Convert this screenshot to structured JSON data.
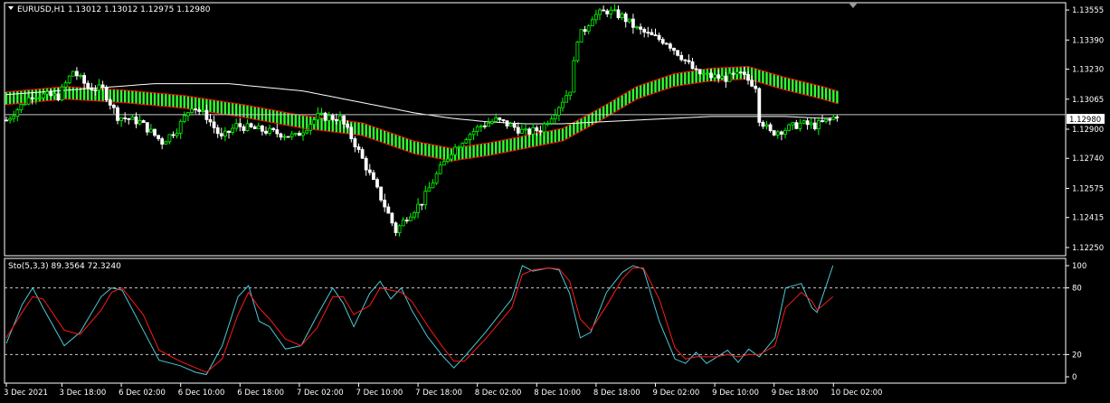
{
  "window": {
    "symbol_line": "EURUSD,H1  1.13012 1.13012 1.12975 1.12980",
    "sto_line": "Sto(5,3,3) 89.3564 72.3240",
    "current_price_label": "1.12980"
  },
  "colors": {
    "background": "#000000",
    "frame": "#ffffff",
    "bull_candle": "#00ff00",
    "bear_candle": "#ffffff",
    "ribbon_fill": "#32ff32",
    "ribbon_edge": "#ff0000",
    "slow_ma": "#ffffff",
    "sto_main": "#4dc8d6",
    "sto_signal": "#ff1a1a",
    "level_lines": "#c8c8c8"
  },
  "chart_data": [
    {
      "type": "candlestick",
      "title": "EURUSD,H1",
      "ohlc_header": {
        "open": 1.13012,
        "high": 1.13012,
        "low": 1.12975,
        "close": 1.1298
      },
      "y_ticks": [
        "1.13555",
        "1.13390",
        "1.13230",
        "1.13065",
        "1.12900",
        "1.12740",
        "1.12575",
        "1.12415",
        "1.12250"
      ],
      "ylim": [
        1.1221,
        1.1359
      ],
      "current_price": 1.1298,
      "x_ticks": [
        "3 Dec 2021",
        "3 Dec 18:00",
        "6 Dec 02:00",
        "6 Dec 10:00",
        "6 Dec 18:00",
        "7 Dec 02:00",
        "7 Dec 10:00",
        "7 Dec 18:00",
        "8 Dec 02:00",
        "8 Dec 10:00",
        "8 Dec 18:00",
        "9 Dec 02:00",
        "9 Dec 10:00",
        "9 Dec 18:00",
        "10 Dec 02:00"
      ],
      "x_tick_index": [
        0,
        15,
        31,
        47,
        63,
        79,
        95,
        111,
        127,
        143,
        159,
        175,
        191,
        207,
        223
      ],
      "close_path": [
        [
          0,
          1.1295
        ],
        [
          7,
          1.1309
        ],
        [
          14,
          1.1308
        ],
        [
          18,
          1.1322
        ],
        [
          22,
          1.1313
        ],
        [
          26,
          1.1312
        ],
        [
          30,
          1.1297
        ],
        [
          36,
          1.1294
        ],
        [
          42,
          1.1283
        ],
        [
          46,
          1.129
        ],
        [
          50,
          1.1303
        ],
        [
          54,
          1.1297
        ],
        [
          58,
          1.1285
        ],
        [
          62,
          1.1292
        ],
        [
          70,
          1.1289
        ],
        [
          78,
          1.1286
        ],
        [
          84,
          1.1297
        ],
        [
          90,
          1.1296
        ],
        [
          94,
          1.1282
        ],
        [
          98,
          1.1265
        ],
        [
          102,
          1.1248
        ],
        [
          105,
          1.1234
        ],
        [
          108,
          1.1242
        ],
        [
          112,
          1.125
        ],
        [
          116,
          1.1265
        ],
        [
          120,
          1.1278
        ],
        [
          124,
          1.1286
        ],
        [
          128,
          1.1292
        ],
        [
          132,
          1.1295
        ],
        [
          136,
          1.1292
        ],
        [
          140,
          1.1288
        ],
        [
          144,
          1.129
        ],
        [
          148,
          1.13
        ],
        [
          152,
          1.1312
        ],
        [
          154,
          1.134
        ],
        [
          156,
          1.1345
        ],
        [
          158,
          1.1352
        ],
        [
          162,
          1.1355
        ],
        [
          166,
          1.1352
        ],
        [
          170,
          1.1345
        ],
        [
          174,
          1.1341
        ],
        [
          178,
          1.1338
        ],
        [
          182,
          1.133
        ],
        [
          186,
          1.1321
        ],
        [
          190,
          1.1319
        ],
        [
          194,
          1.1318
        ],
        [
          198,
          1.132
        ],
        [
          202,
          1.1314
        ],
        [
          203,
          1.1296
        ],
        [
          206,
          1.1288
        ],
        [
          210,
          1.129
        ],
        [
          214,
          1.1293
        ],
        [
          218,
          1.1292
        ],
        [
          222,
          1.1295
        ],
        [
          224,
          1.1298
        ]
      ],
      "ribbon_path": [
        [
          0,
          1.1307
        ],
        [
          16,
          1.131
        ],
        [
          32,
          1.1308
        ],
        [
          48,
          1.1305
        ],
        [
          64,
          1.13
        ],
        [
          80,
          1.1294
        ],
        [
          96,
          1.129
        ],
        [
          110,
          1.128
        ],
        [
          120,
          1.1276
        ],
        [
          130,
          1.1279
        ],
        [
          140,
          1.1283
        ],
        [
          150,
          1.1287
        ],
        [
          160,
          1.1298
        ],
        [
          170,
          1.131
        ],
        [
          180,
          1.1317
        ],
        [
          190,
          1.132
        ],
        [
          200,
          1.1321
        ],
        [
          210,
          1.1315
        ],
        [
          220,
          1.131
        ],
        [
          225,
          1.1307
        ]
      ],
      "ribbon_width": 0.00035,
      "slow_ma_path": [
        [
          0,
          1.1309
        ],
        [
          20,
          1.1312
        ],
        [
          40,
          1.1315
        ],
        [
          60,
          1.1315
        ],
        [
          80,
          1.1311
        ],
        [
          100,
          1.1303
        ],
        [
          110,
          1.1299
        ],
        [
          120,
          1.1296
        ],
        [
          130,
          1.1294
        ],
        [
          140,
          1.1293
        ],
        [
          150,
          1.1293
        ],
        [
          160,
          1.1294
        ],
        [
          170,
          1.1295
        ],
        [
          180,
          1.1296
        ],
        [
          190,
          1.1297
        ],
        [
          200,
          1.1297
        ],
        [
          210,
          1.1297
        ],
        [
          220,
          1.1296
        ],
        [
          225,
          1.1296
        ]
      ]
    },
    {
      "type": "line",
      "title": "Sto(5,3,3)",
      "values_header": {
        "main": 89.3564,
        "signal": 72.324
      },
      "y_ticks": [
        "100",
        "80",
        "20",
        "0"
      ],
      "levels": [
        80,
        20
      ],
      "ylim": [
        0,
        100
      ],
      "series": [
        {
          "name": "Main",
          "points": [
            [
              0,
              30
            ],
            [
              3,
              65
            ],
            [
              5,
              80
            ],
            [
              7,
              62
            ],
            [
              11,
              28
            ],
            [
              14,
              40
            ],
            [
              18,
              72
            ],
            [
              20,
              80
            ],
            [
              22,
              78
            ],
            [
              26,
              42
            ],
            [
              29,
              15
            ],
            [
              33,
              10
            ],
            [
              36,
              4
            ],
            [
              38,
              2
            ],
            [
              41,
              28
            ],
            [
              44,
              72
            ],
            [
              46,
              82
            ],
            [
              48,
              50
            ],
            [
              50,
              45
            ],
            [
              53,
              25
            ],
            [
              56,
              28
            ],
            [
              59,
              55
            ],
            [
              62,
              80
            ],
            [
              64,
              66
            ],
            [
              66,
              45
            ],
            [
              69,
              75
            ],
            [
              71,
              86
            ],
            [
              73,
              70
            ],
            [
              75,
              80
            ],
            [
              77,
              60
            ],
            [
              80,
              36
            ],
            [
              83,
              18
            ],
            [
              85,
              8
            ],
            [
              87,
              18
            ],
            [
              91,
              40
            ],
            [
              96,
              70
            ],
            [
              98,
              100
            ],
            [
              100,
              95
            ],
            [
              103,
              98
            ],
            [
              105,
              96
            ],
            [
              107,
              75
            ],
            [
              109,
              35
            ],
            [
              111,
              40
            ],
            [
              114,
              76
            ],
            [
              117,
              94
            ],
            [
              119,
              100
            ],
            [
              121,
              97
            ],
            [
              124,
              50
            ],
            [
              127,
              16
            ],
            [
              129,
              12
            ],
            [
              131,
              22
            ],
            [
              133,
              12
            ],
            [
              135,
              18
            ],
            [
              137,
              24
            ],
            [
              139,
              13
            ],
            [
              141,
              25
            ],
            [
              143,
              18
            ],
            [
              146,
              35
            ],
            [
              148,
              80
            ],
            [
              151,
              84
            ],
            [
              153,
              62
            ],
            [
              154,
              58
            ],
            [
              157,
              100
            ]
          ]
        },
        {
          "name": "Signal",
          "points": [
            [
              0,
              35
            ],
            [
              3,
              58
            ],
            [
              5,
              72
            ],
            [
              7,
              70
            ],
            [
              11,
              42
            ],
            [
              14,
              38
            ],
            [
              18,
              60
            ],
            [
              20,
              76
            ],
            [
              22,
              80
            ],
            [
              26,
              56
            ],
            [
              29,
              24
            ],
            [
              33,
              14
            ],
            [
              36,
              8
            ],
            [
              38,
              4
            ],
            [
              41,
              16
            ],
            [
              44,
              56
            ],
            [
              46,
              76
            ],
            [
              48,
              62
            ],
            [
              50,
              52
            ],
            [
              53,
              34
            ],
            [
              56,
              28
            ],
            [
              59,
              44
            ],
            [
              62,
              72
            ],
            [
              64,
              72
            ],
            [
              66,
              56
            ],
            [
              69,
              64
            ],
            [
              71,
              80
            ],
            [
              73,
              78
            ],
            [
              75,
              76
            ],
            [
              77,
              68
            ],
            [
              80,
              46
            ],
            [
              83,
              26
            ],
            [
              85,
              14
            ],
            [
              87,
              14
            ],
            [
              91,
              34
            ],
            [
              96,
              62
            ],
            [
              98,
              92
            ],
            [
              100,
              96
            ],
            [
              103,
              98
            ],
            [
              105,
              97
            ],
            [
              107,
              86
            ],
            [
              109,
              52
            ],
            [
              111,
              42
            ],
            [
              114,
              64
            ],
            [
              117,
              88
            ],
            [
              119,
              98
            ],
            [
              121,
              98
            ],
            [
              124,
              70
            ],
            [
              127,
              26
            ],
            [
              129,
              16
            ],
            [
              131,
              18
            ],
            [
              133,
              18
            ],
            [
              135,
              18
            ],
            [
              137,
              20
            ],
            [
              139,
              18
            ],
            [
              141,
              20
            ],
            [
              143,
              20
            ],
            [
              146,
              28
            ],
            [
              148,
              62
            ],
            [
              151,
              76
            ],
            [
              153,
              68
            ],
            [
              154,
              60
            ],
            [
              157,
              72
            ]
          ]
        }
      ]
    }
  ]
}
